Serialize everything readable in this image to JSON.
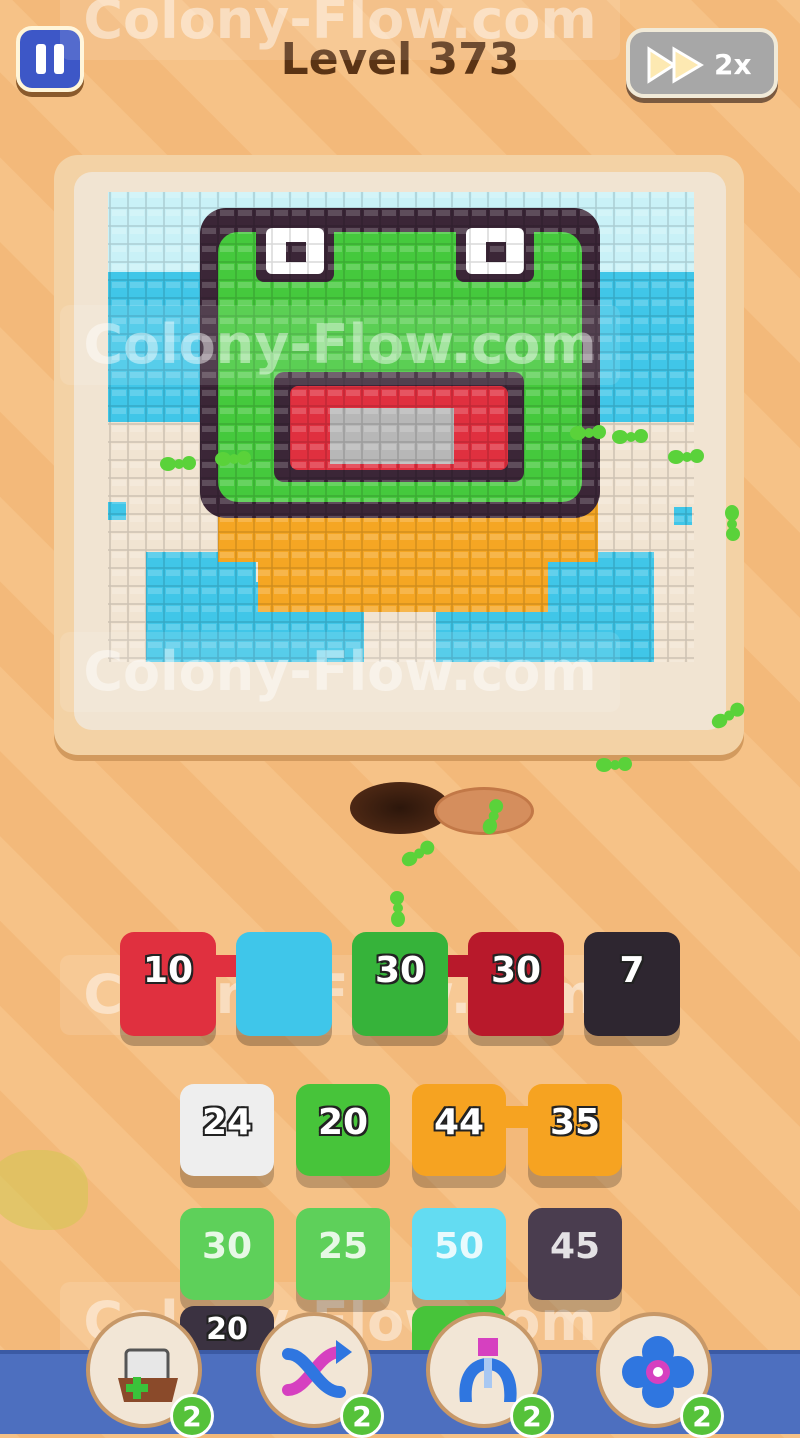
{
  "header": {
    "level_title": "Level 373",
    "speed_label": "2x"
  },
  "watermark": "Colony-Flow.com",
  "slots": [
    {
      "value": "10",
      "color": "#e0303f"
    },
    {
      "value": "",
      "color": "#3fc6ea"
    },
    {
      "value": "30",
      "color": "#36b33a"
    },
    {
      "value": "30",
      "color": "#b8192b"
    },
    {
      "value": "7",
      "color": "#2e2630"
    }
  ],
  "tiles": {
    "row1": [
      {
        "value": "24",
        "color": "#eeeeee"
      },
      {
        "value": "20",
        "color": "#47c43a"
      },
      {
        "value": "44",
        "color": "#f6a321"
      },
      {
        "value": "35",
        "color": "#f6a321"
      }
    ],
    "row2": [
      {
        "value": "30",
        "color": "#5ed05a"
      },
      {
        "value": "25",
        "color": "#5ed05a"
      },
      {
        "value": "50",
        "color": "#63dcf2"
      },
      {
        "value": "45",
        "color": "#4a3d4f"
      }
    ],
    "row3_partial": [
      "20"
    ]
  },
  "boosters": [
    {
      "name": "add-slot",
      "count": "2"
    },
    {
      "name": "shuffle",
      "count": "2"
    },
    {
      "name": "magnet",
      "count": "2"
    },
    {
      "name": "flower",
      "count": "2"
    }
  ],
  "colors": {
    "background": "#f6c287",
    "ant": "#5ad23a"
  }
}
